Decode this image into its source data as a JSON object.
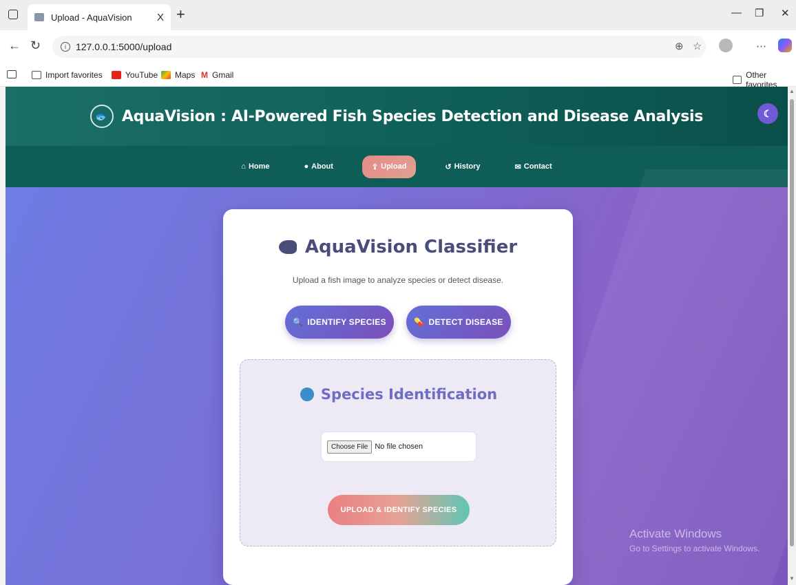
{
  "browser": {
    "tab_title": "Upload - AquaVision",
    "tab_close": "X",
    "new_tab": "+",
    "url": "127.0.0.1:5000/upload",
    "bookmarks": [
      "Import favorites",
      "YouTube",
      "Maps",
      "Gmail"
    ],
    "other_favorites": "Other favorites"
  },
  "header": {
    "title": "AquaVision : AI-Powered Fish Species Detection and Disease Analysis"
  },
  "nav": {
    "items": [
      {
        "label": "Home",
        "icon": "home-icon"
      },
      {
        "label": "About",
        "icon": "info-icon"
      },
      {
        "label": "Upload",
        "icon": "upload-icon"
      },
      {
        "label": "History",
        "icon": "history-icon"
      },
      {
        "label": "Contact",
        "icon": "mail-icon"
      }
    ],
    "active": "Upload"
  },
  "card": {
    "title": "AquaVision Classifier",
    "subtitle": "Upload a fish image to analyze species or detect disease.",
    "identify_label": "IDENTIFY SPECIES",
    "detect_label": "DETECT DISEASE",
    "section_title": "Species Identification",
    "choose_file": "Choose File",
    "no_file": "No file chosen",
    "submit_label": "UPLOAD & IDENTIFY SPECIES"
  },
  "watermark": {
    "line1": "Activate Windows",
    "line2": "Go to Settings to activate Windows."
  },
  "colors": {
    "header_bg": "#0e5d57",
    "accent_purple": "#6f6cc4",
    "active_tab": "#e78a86"
  }
}
